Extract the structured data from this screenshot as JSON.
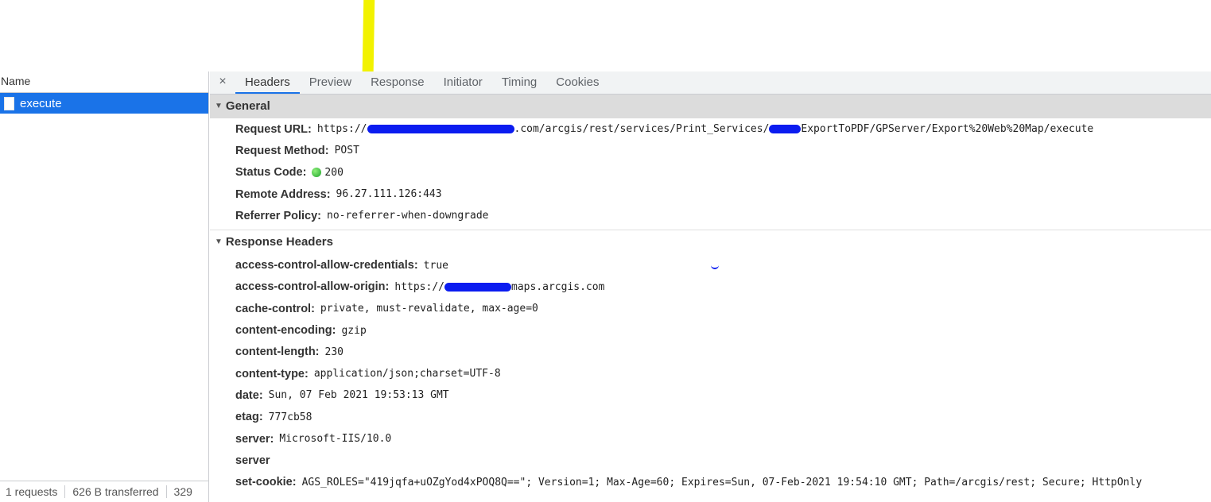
{
  "left_panel": {
    "column_header": "Name",
    "requests": [
      {
        "name": "execute",
        "selected": true
      }
    ],
    "status_bar": {
      "requests": "1 requests",
      "transferred": "626 B transferred",
      "truncated": "329"
    }
  },
  "tabs": {
    "close_glyph": "×",
    "items": [
      "Headers",
      "Preview",
      "Response",
      "Initiator",
      "Timing",
      "Cookies"
    ],
    "active": "Headers"
  },
  "general": {
    "title": "General",
    "request_url_label": "Request URL:",
    "request_url_prefix": "https://",
    "request_url_mid": ".com/arcgis/rest/services/Print_Services/",
    "request_url_suffix": "ExportToPDF/GPServer/Export%20Web%20Map/execute",
    "request_method_label": "Request Method:",
    "request_method": "POST",
    "status_code_label": "Status Code:",
    "status_code": "200",
    "remote_address_label": "Remote Address:",
    "remote_address": "96.27.111.126:443",
    "referrer_policy_label": "Referrer Policy:",
    "referrer_policy": "no-referrer-when-downgrade"
  },
  "response_headers": {
    "title": "Response Headers",
    "acao_label": "access-control-allow-origin:",
    "acao_prefix": "https://",
    "acao_suffix": "maps.arcgis.com",
    "items": [
      {
        "key": "access-control-allow-credentials:",
        "value": "true"
      },
      {
        "key": "cache-control:",
        "value": "private, must-revalidate, max-age=0"
      },
      {
        "key": "content-encoding:",
        "value": "gzip"
      },
      {
        "key": "content-length:",
        "value": "230"
      },
      {
        "key": "content-type:",
        "value": "application/json;charset=UTF-8"
      },
      {
        "key": "date:",
        "value": "Sun, 07 Feb 2021 19:53:13 GMT"
      },
      {
        "key": "etag:",
        "value": "777cb58"
      },
      {
        "key": "server:",
        "value": "Microsoft-IIS/10.0"
      },
      {
        "key": "server",
        "value": ""
      },
      {
        "key": "set-cookie:",
        "value": "AGS_ROLES=\"419jqfa+uOZgYod4xPOQ8Q==\"; Version=1; Max-Age=60; Expires=Sun, 07-Feb-2021 19:54:10 GMT; Path=/arcgis/rest; Secure; HttpOnly"
      }
    ]
  },
  "colors": {
    "selection": "#1a73e8",
    "annotation_yellow": "#f2f200",
    "redaction_blue": "#0b1cf0",
    "status_green": "#1fa32b"
  }
}
